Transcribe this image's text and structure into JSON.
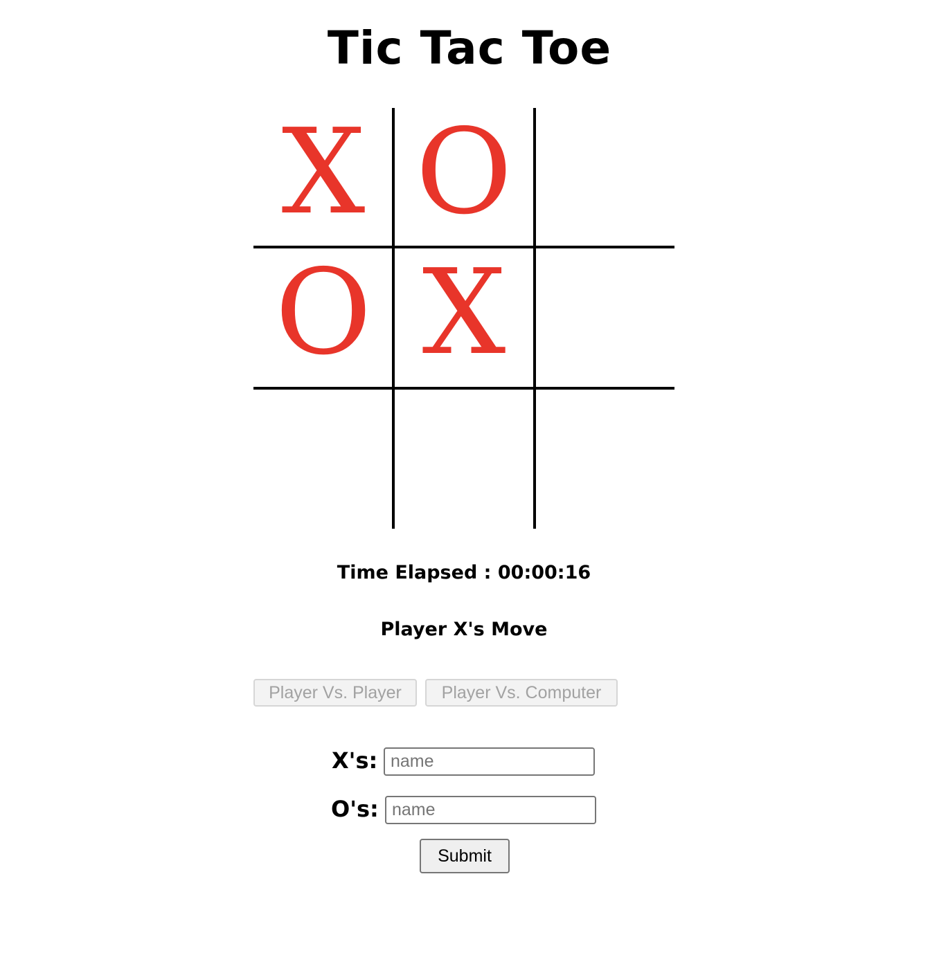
{
  "title": "Tic Tac Toe",
  "board": {
    "cells": [
      "X",
      "O",
      "",
      "O",
      "X",
      "",
      "",
      "",
      ""
    ],
    "mark_color": "#e8352a",
    "line_color": "#000000"
  },
  "timer": {
    "label": "Time Elapsed : 00:00:16"
  },
  "status": {
    "text": "Player X's Move"
  },
  "modes": {
    "pvp_label": "Player Vs. Player",
    "pvc_label": "Player Vs. Computer"
  },
  "players": {
    "x_label": "X's:",
    "x_placeholder": "name",
    "x_value": "",
    "o_label": "O's:",
    "o_placeholder": "name",
    "o_value": ""
  },
  "submit_label": "Submit"
}
